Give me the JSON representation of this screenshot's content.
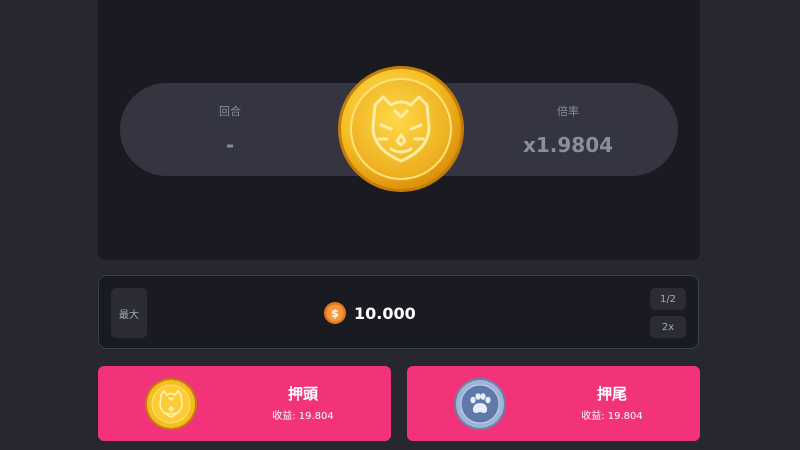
{
  "game": {
    "round_label": "回合",
    "round_value": "-",
    "multiplier_label": "倍率",
    "multiplier_value": "x1.9804"
  },
  "bet": {
    "max_label": "最大",
    "amount": "10.000",
    "half_label": "1/2",
    "double_label": "2x",
    "coin_symbol": "$"
  },
  "choices": {
    "heads": {
      "title": "押頭",
      "payout": "收益: 19.804",
      "icon": "tiger-coin-icon"
    },
    "tails": {
      "title": "押尾",
      "payout": "收益: 19.804",
      "icon": "paw-coin-icon"
    }
  },
  "colors": {
    "background": "#262731",
    "panel": "#191a22",
    "accent": "#f2337a",
    "coin_gold": "#f4b71c",
    "coin_silver": "#6f88b5"
  }
}
